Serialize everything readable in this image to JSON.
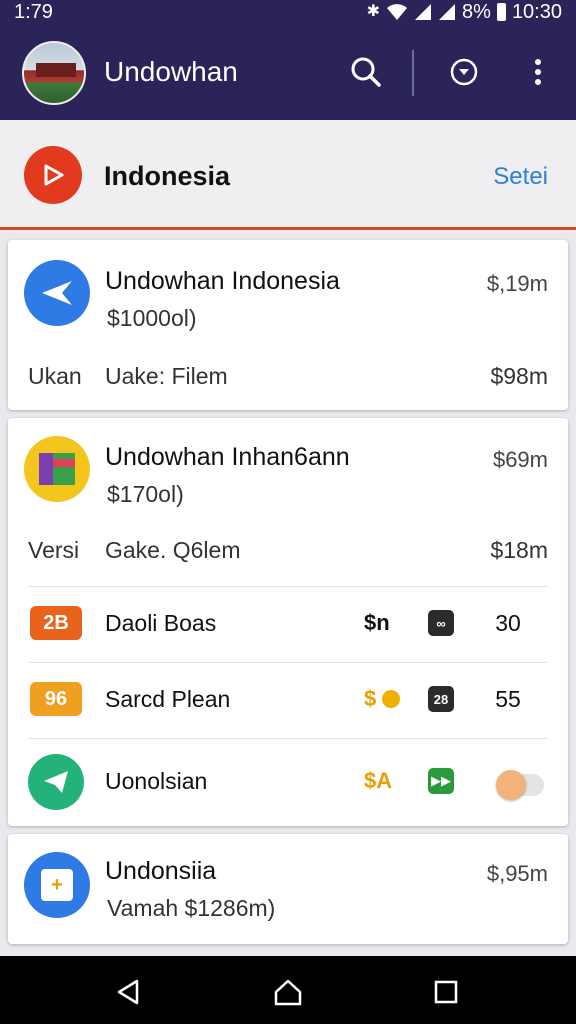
{
  "status_bar": {
    "time": "1:79",
    "battery": "8%",
    "clock": "10:30"
  },
  "app_bar": {
    "title": "Undowhan"
  },
  "section_header": {
    "label": "Indonesia",
    "action": "Setei"
  },
  "cards": [
    {
      "name": "Undowhan Indonesia",
      "subtitle": "$1000ol)",
      "amount": "$,19m",
      "meta_left": "Ukan",
      "meta_mid": "Uake: Filem",
      "meta_right": "$98m"
    },
    {
      "name": "Undowhan Inhan6ann",
      "subtitle": "$170ol)",
      "amount": "$69m",
      "meta_left": "Versi",
      "meta_mid": "Gake. Q6lem",
      "meta_right": "$18m",
      "rows": [
        {
          "badge": "2B",
          "name": "Daoli Boas",
          "dollar": "$n",
          "icon_text": "∞",
          "value": "30"
        },
        {
          "badge": "96",
          "name": "Sarcd Plean",
          "dollar": "$",
          "icon_text": "28",
          "value": "55"
        },
        {
          "name": "Uonolsian",
          "dollar": "$A",
          "icon_text": "▶▶",
          "toggle_on": false
        }
      ]
    },
    {
      "name": "Undonsiia",
      "subtitle": "Vamah $1286m)",
      "amount": "$,95m"
    }
  ],
  "colors": {
    "primary": "#2a2459",
    "accent_red": "#e23a1e",
    "link_blue": "#2d80d6",
    "badge_orange_1": "#e8641c",
    "badge_orange_2": "#f0a020",
    "icon_dark": "#2b2b2b",
    "icon_green": "#2b9a3a"
  },
  "icons": [
    "search-icon",
    "dropdown-circle-icon",
    "more-vert-icon",
    "play-icon",
    "send-icon",
    "app-icon",
    "telegram-icon",
    "phone-app-icon",
    "back-icon",
    "home-icon",
    "recents-icon"
  ]
}
